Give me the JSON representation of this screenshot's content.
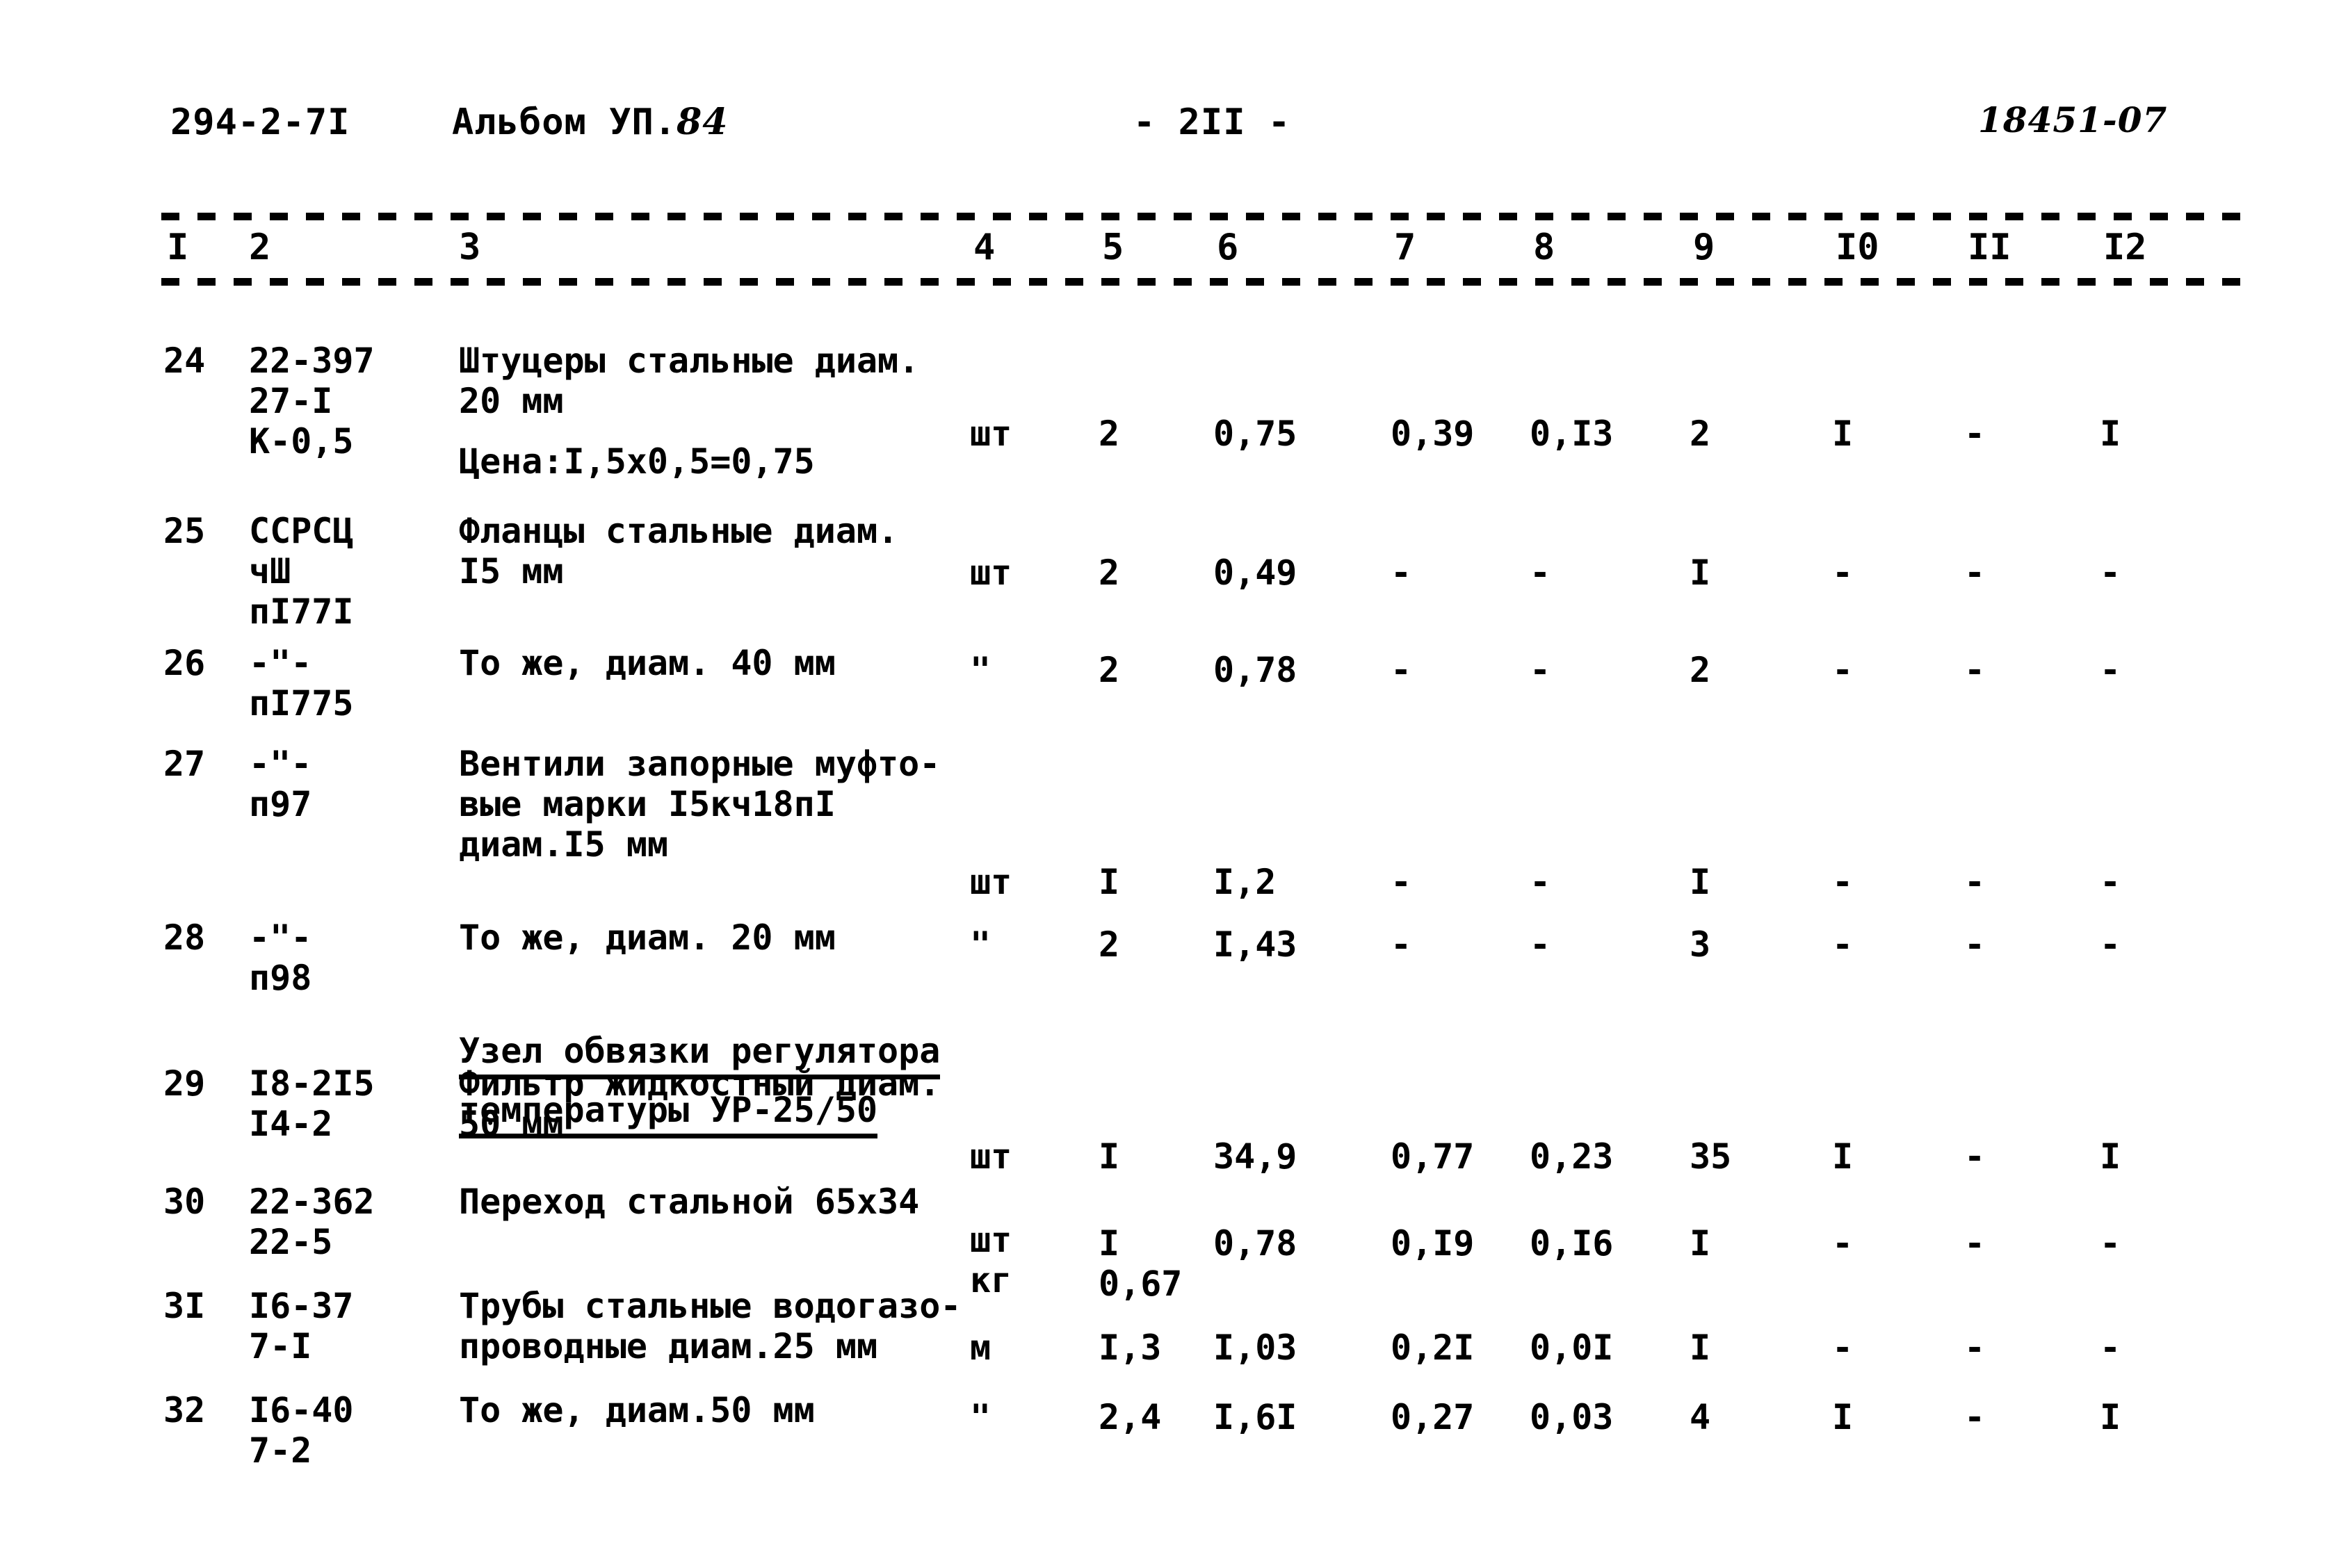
{
  "header": {
    "doc_code": "294-2-7I",
    "album": "Альбом УП.",
    "album_number": "84",
    "page_marker": "- 2II -",
    "stamp": "18451-07"
  },
  "table": {
    "column_numbers": [
      "I",
      "2",
      "3",
      "4",
      "5",
      "6",
      "7",
      "8",
      "9",
      "I0",
      "II",
      "I2"
    ],
    "rows": [
      {
        "num": "24",
        "code": "22-397\n27-I\nК-0,5",
        "name": "Штуцеры стальные диам.\n20 мм",
        "name_extra": "Цена:I,5х0,5=0,75",
        "unit": "шт",
        "v5": "2",
        "v6": "0,75",
        "v7": "0,39",
        "v8": "0,I3",
        "v9": "2",
        "v10": "I",
        "v11": "-",
        "v12": "I"
      },
      {
        "num": "25",
        "code": "ССРСЦ\nчШ\nпI77I",
        "name": "Фланцы стальные диам.\nI5 мм",
        "name_extra": "",
        "unit": "шт",
        "v5": "2",
        "v6": "0,49",
        "v7": "-",
        "v8": "-",
        "v9": "I",
        "v10": "-",
        "v11": "-",
        "v12": "-"
      },
      {
        "num": "26",
        "code": "-\"-\nпI775",
        "name": "То же, диам. 40 мм",
        "name_extra": "",
        "unit": "\"",
        "v5": "2",
        "v6": "0,78",
        "v7": "-",
        "v8": "-",
        "v9": "2",
        "v10": "-",
        "v11": "-",
        "v12": "-"
      },
      {
        "num": "27",
        "code": "-\"-\nп97",
        "name": "Вентили запорные муфто-\nвые марки I5кч18пI\nдиам.I5 мм",
        "name_extra": "",
        "unit": "шт",
        "v5": "I",
        "v6": "I,2",
        "v7": "-",
        "v8": "-",
        "v9": "I",
        "v10": "-",
        "v11": "-",
        "v12": "-"
      },
      {
        "num": "28",
        "code": "-\"-\nп98",
        "name": "То же, диам. 20 мм",
        "name_extra": "",
        "unit": "\"",
        "v5": "2",
        "v6": "I,43",
        "v7": "-",
        "v8": "-",
        "v9": "3",
        "v10": "-",
        "v11": "-",
        "v12": "-"
      },
      {
        "num": "29",
        "code": "I8-2I5\nI4-2",
        "name": "Фильтр жидкостный диам.\n50 мм",
        "name_extra": "",
        "unit": "шт",
        "v5": "I",
        "v6": "34,9",
        "v7": "0,77",
        "v8": "0,23",
        "v9": "35",
        "v10": "I",
        "v11": "-",
        "v12": "I"
      },
      {
        "num": "30",
        "code": "22-362\n22-5",
        "name": "Переход стальной 65х34",
        "name_extra": "",
        "unit": "шт\nкг",
        "v5": "I\n0,67",
        "v6": "0,78",
        "v7": "0,I9",
        "v8": "0,I6",
        "v9": "I",
        "v10": "-",
        "v11": "-",
        "v12": "-"
      },
      {
        "num": "3I",
        "code": "I6-37\n7-I",
        "name": "Трубы стальные водогазо-\nпроводные диам.25 мм",
        "name_extra": "",
        "unit": "м",
        "v5": "I,3",
        "v6": "I,03",
        "v7": "0,2I",
        "v8": "0,0I",
        "v9": "I",
        "v10": "-",
        "v11": "-",
        "v12": "-"
      },
      {
        "num": "32",
        "code": "I6-40\n7-2",
        "name": "То же, диам.50 мм",
        "name_extra": "",
        "unit": "\"",
        "v5": "2,4",
        "v6": "I,6I",
        "v7": "0,27",
        "v8": "0,03",
        "v9": "4",
        "v10": "I",
        "v11": "-",
        "v12": "I"
      }
    ],
    "section_heading": {
      "line1": "Узел обвязки регулятора",
      "line2": "температуры УР-25/50"
    }
  }
}
